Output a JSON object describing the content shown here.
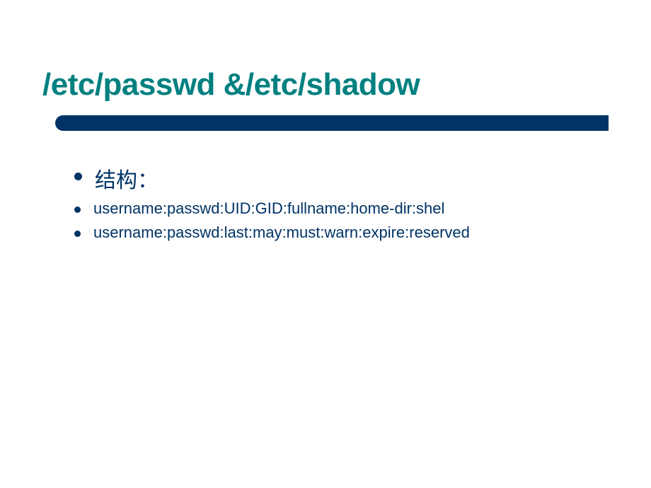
{
  "slide": {
    "title": "/etc/passwd &/etc/shadow",
    "items": [
      {
        "text": "结构：",
        "size": "large"
      },
      {
        "text": "username:passwd:UID:GID:fullname:home-dir:shel",
        "size": "small"
      },
      {
        "text": "username:passwd:last:may:must:warn:expire:reserved",
        "size": "small"
      }
    ]
  }
}
